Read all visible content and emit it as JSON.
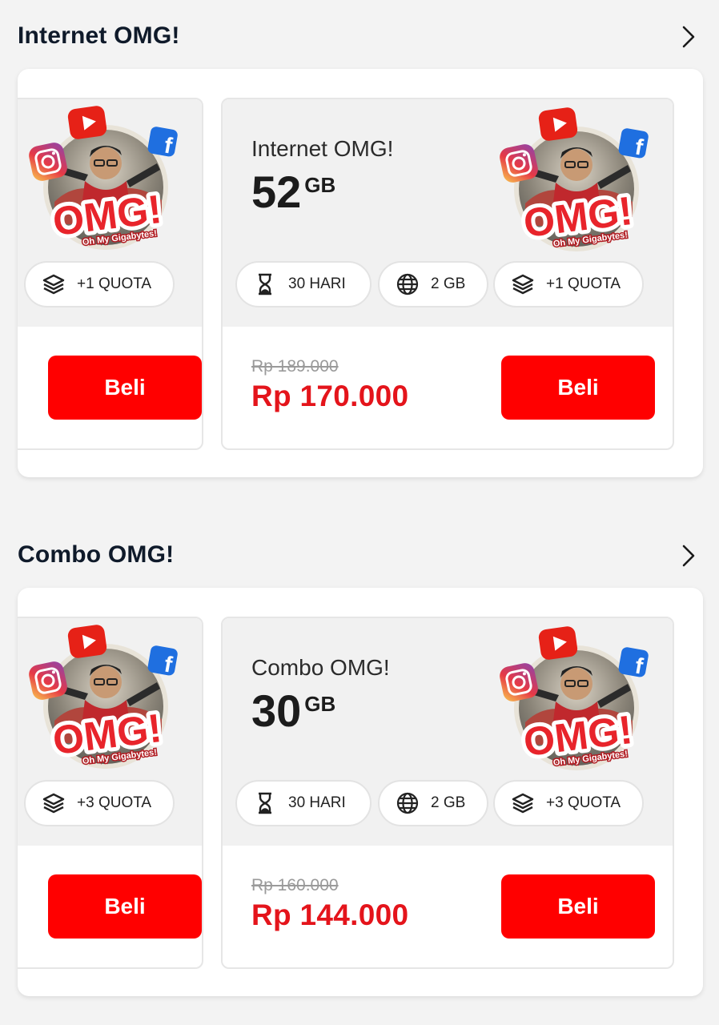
{
  "colors": {
    "accent": "#ff0000",
    "price_red": "#e4141b",
    "title": "#0f1a2a"
  },
  "sections": [
    {
      "title": "Internet OMG!",
      "chevron_icon": "chevron-right-icon",
      "left_card": {
        "promo_text": "OMG!",
        "promo_subtext": "Oh My Gigabytes!",
        "chip": "+1 QUOTA",
        "buy_label": "Beli"
      },
      "main_card": {
        "name": "Internet OMG!",
        "quota_value": "52",
        "quota_unit": "GB",
        "promo_text": "OMG!",
        "promo_subtext": "Oh My Gigabytes!",
        "chips": [
          "30 HARI",
          "2 GB",
          "+1 QUOTA"
        ],
        "old_price": "Rp 189.000",
        "price": "Rp 170.000",
        "buy_label": "Beli"
      }
    },
    {
      "title": "Combo OMG!",
      "chevron_icon": "chevron-right-icon",
      "left_card": {
        "promo_text": "OMG!",
        "promo_subtext": "Oh My Gigabytes!",
        "chip": "+3 QUOTA",
        "buy_label": "Beli"
      },
      "main_card": {
        "name": "Combo OMG!",
        "quota_value": "30",
        "quota_unit": "GB",
        "promo_text": "OMG!",
        "promo_subtext": "Oh My Gigabytes!",
        "chips": [
          "30 HARI",
          "2 GB",
          "+3 QUOTA"
        ],
        "old_price": "Rp 160.000",
        "price": "Rp 144.000",
        "buy_label": "Beli"
      }
    }
  ]
}
